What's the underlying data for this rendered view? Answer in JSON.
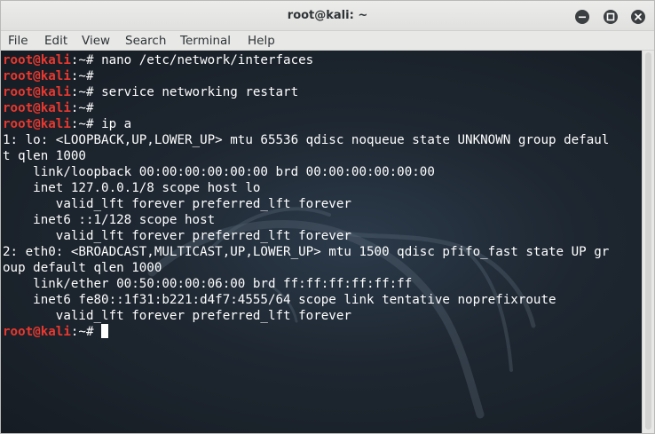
{
  "window": {
    "title": "root@kali: ~"
  },
  "menu": [
    "File",
    "Edit",
    "View",
    "Search",
    "Terminal",
    "Help"
  ],
  "prompt": {
    "user_host": "root@kali",
    "path": ":~",
    "symbol": "# "
  },
  "terminal_lines": [
    {
      "type": "prompt",
      "command": "nano /etc/network/interfaces"
    },
    {
      "type": "prompt",
      "command": ""
    },
    {
      "type": "prompt",
      "command": "service networking restart"
    },
    {
      "type": "prompt",
      "command": ""
    },
    {
      "type": "prompt",
      "command": "ip a"
    },
    {
      "type": "output",
      "text": "1: lo: <LOOPBACK,UP,LOWER_UP> mtu 65536 qdisc noqueue state UNKNOWN group defaul"
    },
    {
      "type": "output",
      "text": "t qlen 1000"
    },
    {
      "type": "output",
      "text": "    link/loopback 00:00:00:00:00:00 brd 00:00:00:00:00:00"
    },
    {
      "type": "output",
      "text": "    inet 127.0.0.1/8 scope host lo"
    },
    {
      "type": "output",
      "text": "       valid_lft forever preferred_lft forever"
    },
    {
      "type": "output",
      "text": "    inet6 ::1/128 scope host"
    },
    {
      "type": "output",
      "text": "       valid_lft forever preferred_lft forever"
    },
    {
      "type": "output",
      "text": "2: eth0: <BROADCAST,MULTICAST,UP,LOWER_UP> mtu 1500 qdisc pfifo_fast state UP gr"
    },
    {
      "type": "output",
      "text": "oup default qlen 1000"
    },
    {
      "type": "output",
      "text": "    link/ether 00:50:00:00:06:00 brd ff:ff:ff:ff:ff:ff"
    },
    {
      "type": "output",
      "text": "    inet6 fe80::1f31:b221:d4f7:4555/64 scope link tentative noprefixroute"
    },
    {
      "type": "output",
      "text": "       valid_lft forever preferred_lft forever"
    },
    {
      "type": "prompt",
      "command": "",
      "cursor": true
    }
  ],
  "colors": {
    "prompt_user": "#e8382f",
    "terminal_text": "#ffffff",
    "terminal_bg": "#1b2129",
    "chrome_bg": "#e8e8e7"
  },
  "icons": {
    "minimize": "minimize-icon",
    "maximize": "maximize-icon",
    "close": "close-icon",
    "background": "kali-dragon-icon"
  }
}
